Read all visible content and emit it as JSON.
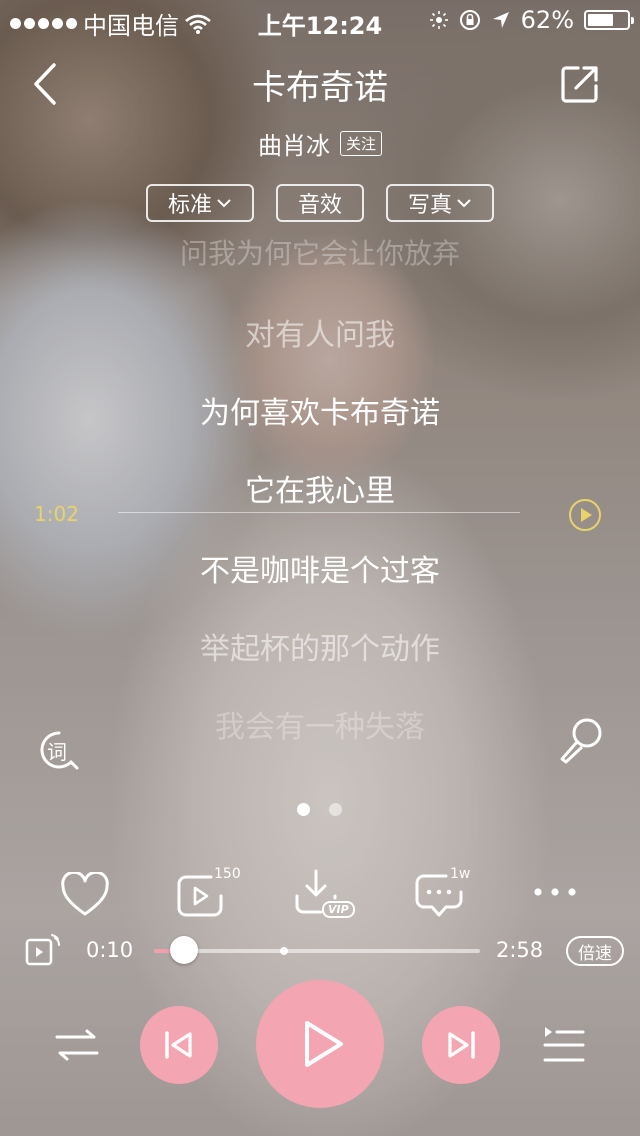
{
  "status_bar": {
    "carrier": "中国电信",
    "time": "上午12:24",
    "battery": "62%",
    "battery_level": 0.62
  },
  "header": {
    "title": "卡布奇诺",
    "artist": "曲肖冰",
    "follow_label": "关注",
    "back_icon": "chevron-left-icon",
    "share_icon": "share-icon"
  },
  "options": {
    "quality_label": "标准",
    "effect_label": "音效",
    "photo_label": "写真"
  },
  "lyrics": {
    "lines": [
      "问我为何它会让你放弃",
      "对有人问我",
      "为何喜欢卡布奇诺",
      "它在我心里",
      "不是咖啡是个过客",
      "举起杯的那个动作",
      "我会有一种失落"
    ],
    "seek_time": "1:02"
  },
  "side_buttons": {
    "lyrics_icon_label": "词",
    "mic_icon": "microphone-icon"
  },
  "pager": {
    "pages": 2,
    "active": 0
  },
  "actions": {
    "like_icon": "heart-icon",
    "play_count": "150",
    "download_badge": "VIP",
    "comment_count": "1w",
    "more_icon": "more-icon"
  },
  "playback": {
    "elapsed": "0:10",
    "duration": "2:58",
    "progress": 0.056,
    "buffered": 0.4,
    "speed_label": "倍速"
  },
  "colors": {
    "accent_pink": "#f4a5b2",
    "seek_time": "#e8d36a"
  }
}
